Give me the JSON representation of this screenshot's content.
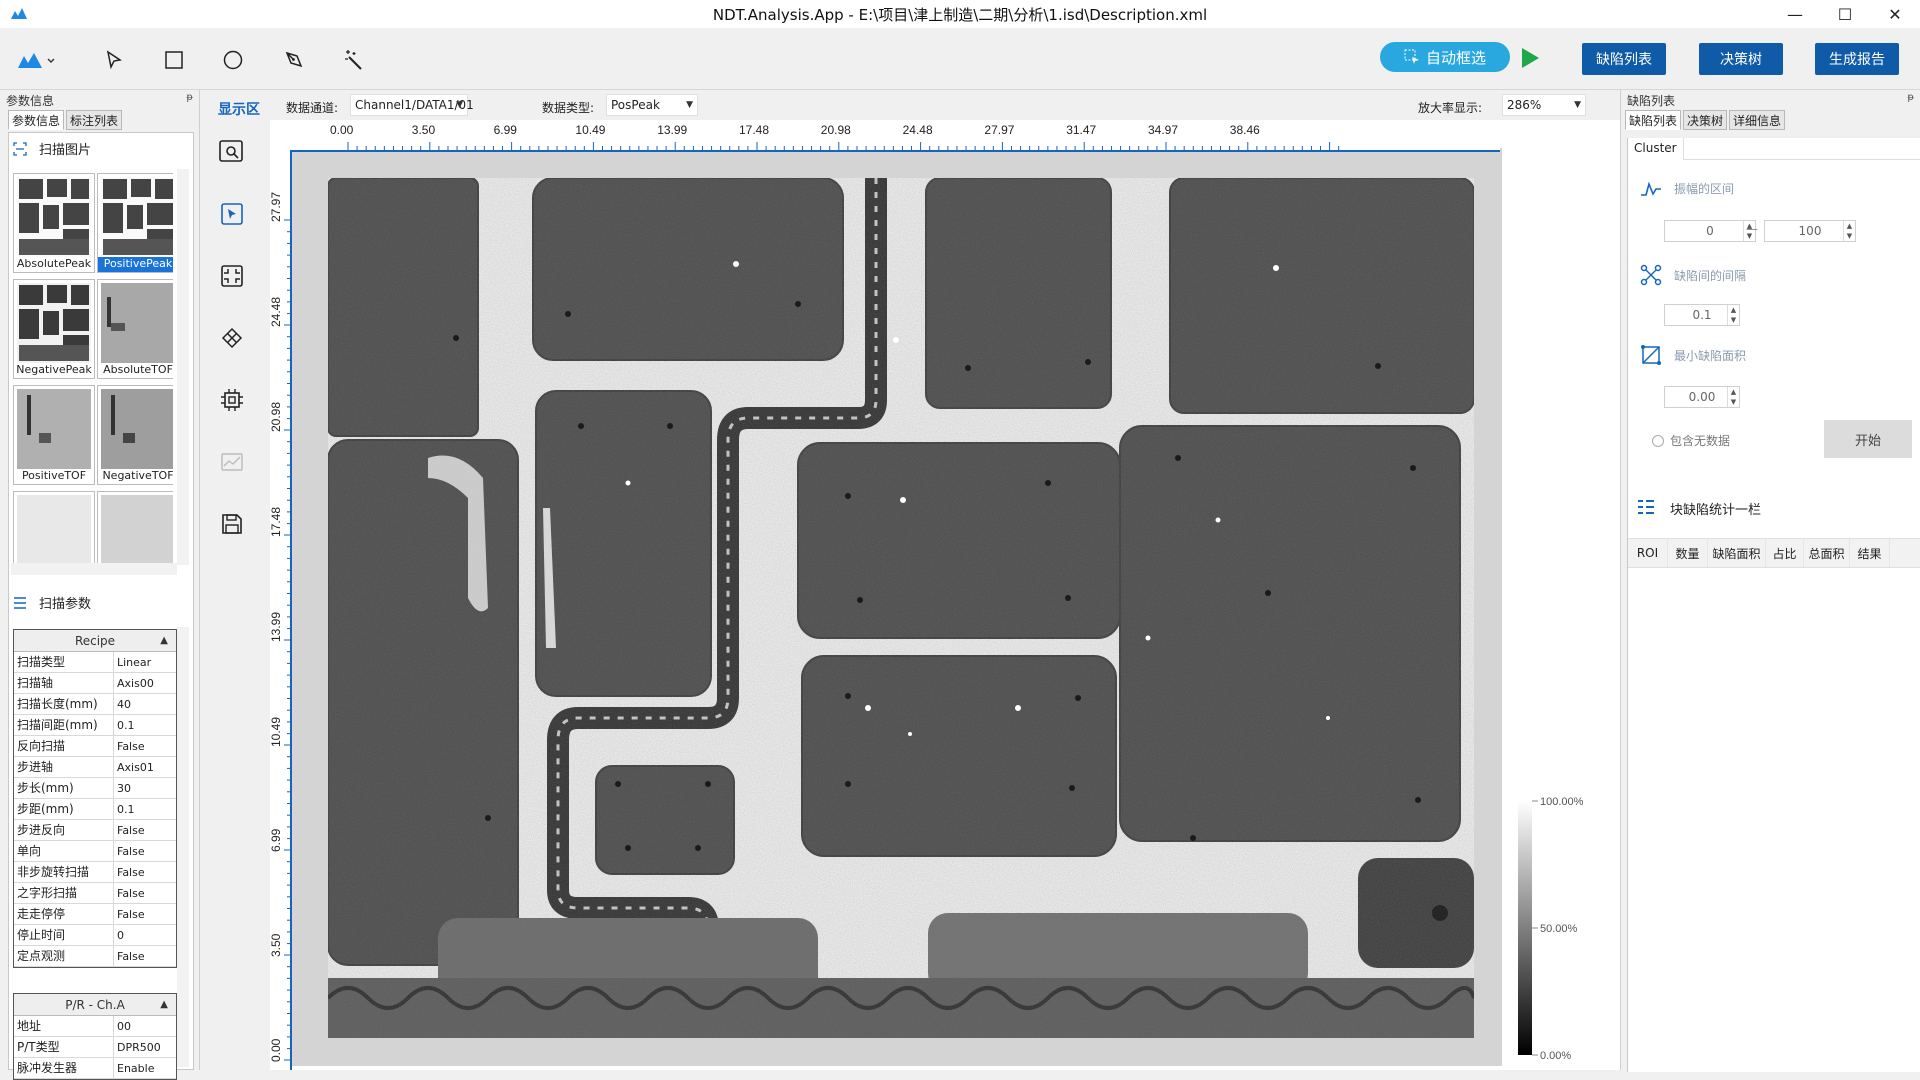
{
  "window": {
    "title": "NDT.Analysis.App  -  E:\\项目\\津上制造\\二期\\分析\\1.isd\\Description.xml",
    "controls": [
      "—",
      "☐",
      "✕"
    ]
  },
  "toolbar": {
    "auto_select": "自动框选",
    "defect_list": "缺陷列表",
    "decision_tree": "决策树",
    "gen_report": "生成报告",
    "accent": "#0f5ba8",
    "auto_color": "#29a8e0",
    "play_color": "#1ea84a"
  },
  "left": {
    "caption": "参数信息",
    "pin": "ᵽ",
    "tabs": [
      "参数信息",
      "标注列表"
    ],
    "scan_images_title": "扫描图片",
    "thumbnails": [
      {
        "label": "AbsolutePeak"
      },
      {
        "label": "PositivePeak"
      },
      {
        "label": "NegativePeak"
      },
      {
        "label": "AbsoluteTOF"
      },
      {
        "label": "PositiveTOF"
      },
      {
        "label": "NegativeTOF"
      },
      {
        "label": ""
      },
      {
        "label": ""
      }
    ],
    "scan_params_title": "扫描参数",
    "recipe_head": "Recipe",
    "recipe": [
      [
        "扫描类型",
        "Linear"
      ],
      [
        "扫描轴",
        "Axis00"
      ],
      [
        "扫描长度(mm)",
        "40"
      ],
      [
        "扫描间距(mm)",
        "0.1"
      ],
      [
        "反向扫描",
        "False"
      ],
      [
        "步进轴",
        "Axis01"
      ],
      [
        "步长(mm)",
        "30"
      ],
      [
        "步距(mm)",
        "0.1"
      ],
      [
        "步进反向",
        "False"
      ],
      [
        "单向",
        "False"
      ],
      [
        "非步旋转扫描",
        "False"
      ],
      [
        "之字形扫描",
        "False"
      ],
      [
        "走走停停",
        "False"
      ],
      [
        "停止时间",
        "0"
      ],
      [
        "定点观测",
        "False"
      ]
    ],
    "pr_head": "P/R - Ch.A",
    "pr": [
      [
        "地址",
        "00"
      ],
      [
        "P/T类型",
        "DPR500"
      ],
      [
        "脉冲发生器",
        "Enable"
      ]
    ]
  },
  "view": {
    "label": "显示区",
    "channel_label": "数据通道:",
    "channel_value": "Channel1/DATA1/01",
    "type_label": "数据类型:",
    "type_value": "PosPeak",
    "zoom_label": "放大率显示:",
    "zoom_value": "286%"
  },
  "ruler": {
    "x_ticks": [
      "0.00",
      "3.50",
      "6.99",
      "10.49",
      "13.99",
      "17.48",
      "20.98",
      "24.48",
      "27.97",
      "31.47",
      "34.97",
      "38.46"
    ],
    "y_ticks": [
      "27.97",
      "24.48",
      "20.98",
      "17.48",
      "13.99",
      "10.49",
      "6.99",
      "3.50",
      "0.00"
    ]
  },
  "colorbar": {
    "labels": [
      "100.00%",
      "50.00%",
      "0.00%"
    ]
  },
  "right": {
    "caption": "缺陷列表",
    "tabs": [
      "缺陷列表",
      "决策树",
      "详细信息"
    ],
    "subtab": "Cluster",
    "amp_range_label": "振幅的区间",
    "amp_min": "0",
    "amp_dash": "—",
    "amp_max": "100",
    "gap_label": "缺陷间的间隔",
    "gap_value": "0.1",
    "min_area_label": "最小缺陷面积",
    "min_area_value": "0.00",
    "include_nodata": "包含无数据",
    "start": "开始",
    "stat_title": "块缺陷统计一栏",
    "columns": [
      "ROI",
      "数量",
      "缺陷面积",
      "占比",
      "总面积",
      "结果"
    ]
  }
}
